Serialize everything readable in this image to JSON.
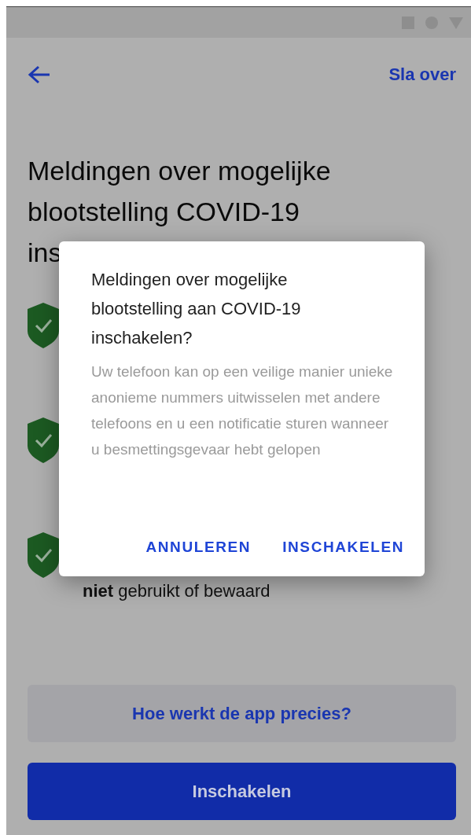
{
  "top_bar": {
    "skip_link": "Sla over"
  },
  "title_lines": [
    "Meldingen over mogelijke",
    "blootstelling COVID-19",
    "ins"
  ],
  "features": [
    {
      "kind": "icon"
    },
    {
      "kind": "icon"
    },
    {
      "kind": "text",
      "text": "**niet** gebruikt of bewaard"
    }
  ],
  "dialog": {
    "title": "Meldingen over mogelijke blootstelling aan COVID-19 inschakelen?",
    "body": "Uw telefoon kan op een veilige manier unieke anonieme nummers uitwisselen met andere telefoons en u een notificatie sturen wanneer u besmettingsgevaar hebt gelopen",
    "buttons": [
      "ANNULEREN",
      "INSCHAKELEN"
    ]
  },
  "secondary_button": "Hoe werkt de app precies?",
  "primary_button": "Inschakelen"
}
